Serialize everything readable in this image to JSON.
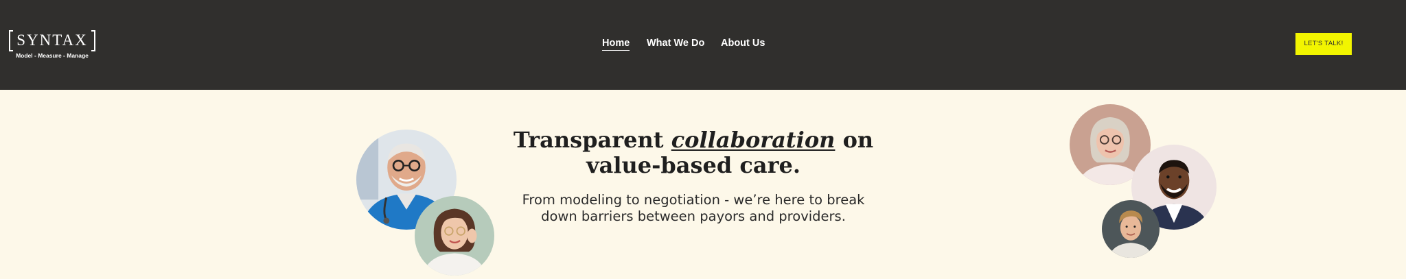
{
  "brand": {
    "name": "SYNTAX",
    "tagline": "Model - Measure - Manage"
  },
  "nav": {
    "items": [
      {
        "label": "Home",
        "active": true
      },
      {
        "label": "What We Do",
        "active": false
      },
      {
        "label": "About Us",
        "active": false
      }
    ],
    "cta_label": "LET'S TALK!"
  },
  "hero": {
    "title_before": "Transparent ",
    "title_emphasis": "collaboration",
    "title_after": " on value-based care.",
    "subtitle": "From modeling to negotiation - we’re here to break down barriers between payors and providers."
  },
  "colors": {
    "nav_bg": "#302f2d",
    "page_bg": "#fdf8e9",
    "cta_bg": "#f2f500"
  },
  "images": [
    "doctor-photo",
    "woman-glasses-photo",
    "older-woman-photo",
    "smiling-man-photo",
    "young-man-photo"
  ]
}
